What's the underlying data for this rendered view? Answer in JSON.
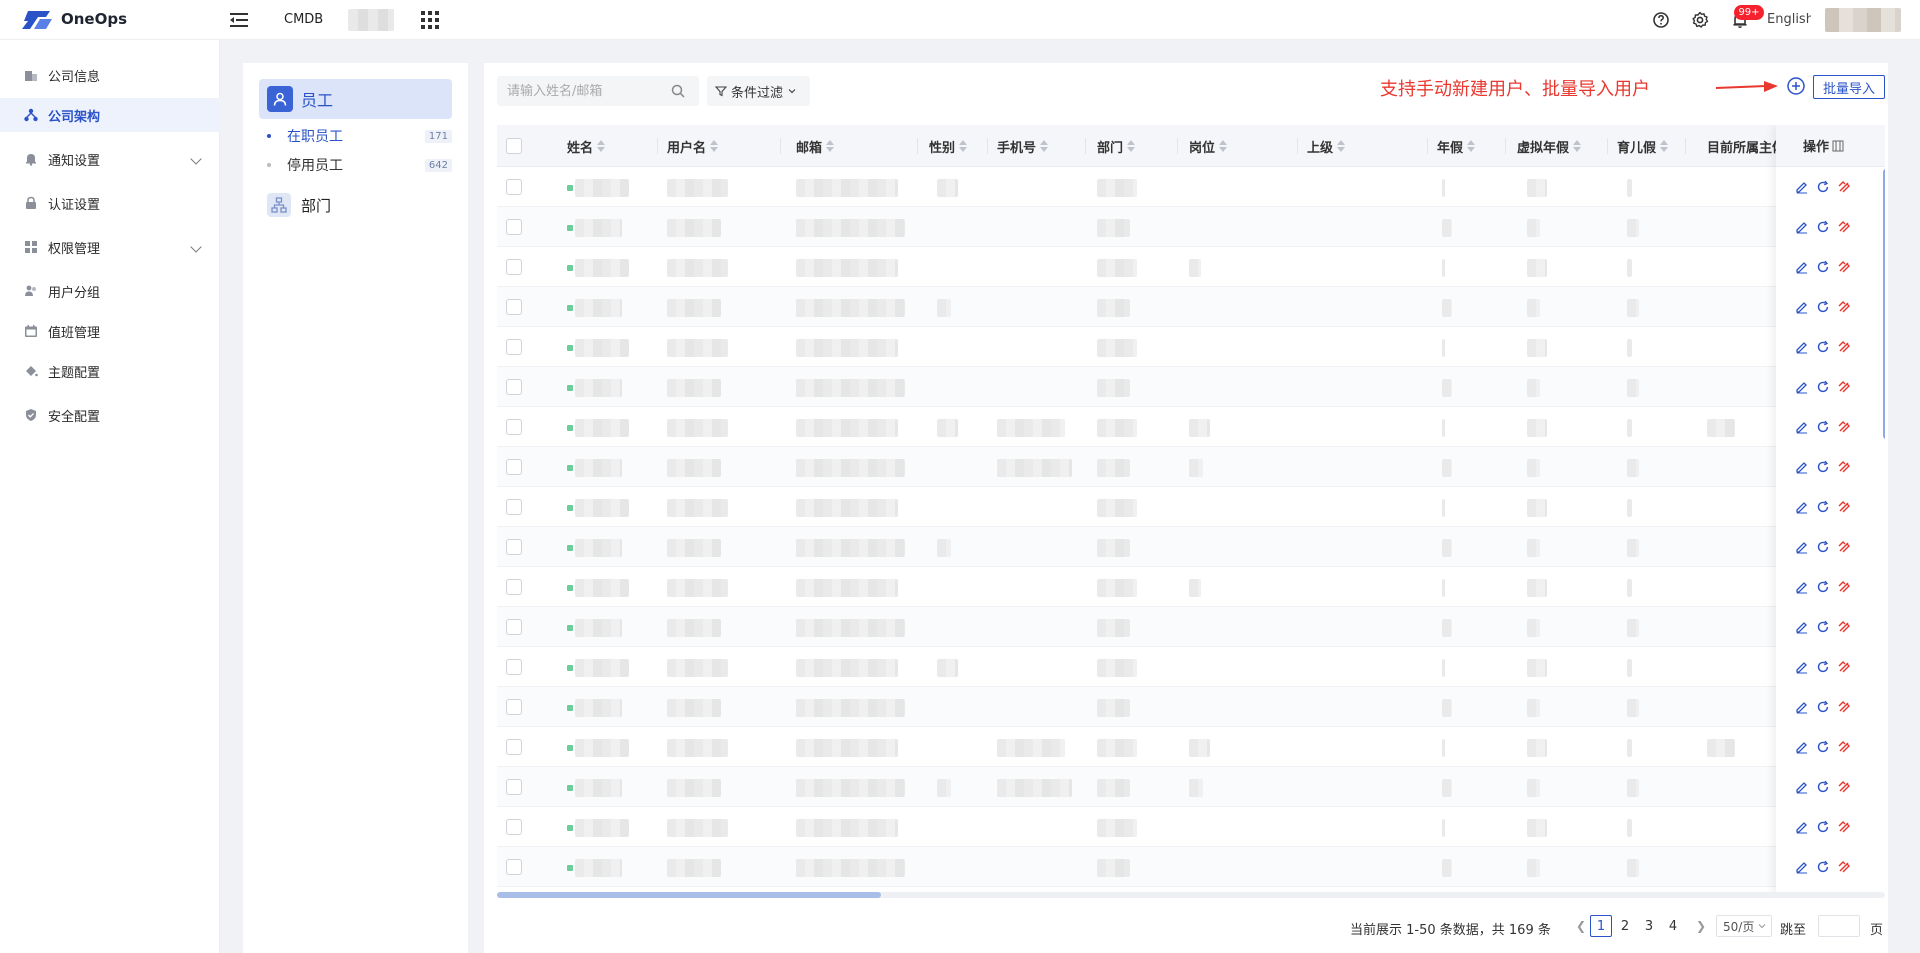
{
  "app": {
    "name": "OneOps",
    "nav_cmdb": "CMDB",
    "lang": "English",
    "notification_badge": "99+"
  },
  "sidebar": {
    "items": [
      {
        "label": "公司信息",
        "icon": "building-icon",
        "active": false
      },
      {
        "label": "公司架构",
        "icon": "org-structure-icon",
        "active": true
      },
      {
        "label": "通知设置",
        "icon": "bell-icon",
        "active": false,
        "expandable": true
      },
      {
        "label": "认证设置",
        "icon": "lock-icon",
        "active": false
      },
      {
        "label": "权限管理",
        "icon": "grid-icon",
        "active": false,
        "expandable": true
      },
      {
        "label": "用户分组",
        "icon": "user-group-icon",
        "active": false
      },
      {
        "label": "值班管理",
        "icon": "calendar-icon",
        "active": false
      },
      {
        "label": "主题配置",
        "icon": "paint-bucket-icon",
        "active": false
      },
      {
        "label": "安全配置",
        "icon": "shield-icon",
        "active": false
      }
    ]
  },
  "tree": {
    "employee_label": "员工",
    "subitems": [
      {
        "label": "在职员工",
        "count": "171",
        "active": true
      },
      {
        "label": "停用员工",
        "count": "642",
        "active": false
      }
    ],
    "department_label": "部门"
  },
  "toolbar": {
    "search_placeholder": "请输入姓名/邮箱",
    "filter_label": "条件过滤",
    "annotation": "支持手动新建用户、批量导入用户",
    "import_label": "批量导入"
  },
  "table": {
    "columns": [
      "姓名",
      "用户名",
      "邮箱",
      "性别",
      "手机号",
      "部门",
      "岗位",
      "上级",
      "年假",
      "虚拟年假",
      "育儿假",
      "目前所属主体"
    ],
    "ops_header": "操作",
    "row_count": 18
  },
  "pager": {
    "total_text": "当前展示 1-50 条数据，共 169 条",
    "pages": [
      "1",
      "2",
      "3",
      "4"
    ],
    "current_page": "1",
    "page_size": "50/页",
    "jump_label": "跳至",
    "page_suffix": "页"
  },
  "colors": {
    "accent": "#2b53c8",
    "annotation": "#e8382f",
    "delete": "#e8382f"
  }
}
